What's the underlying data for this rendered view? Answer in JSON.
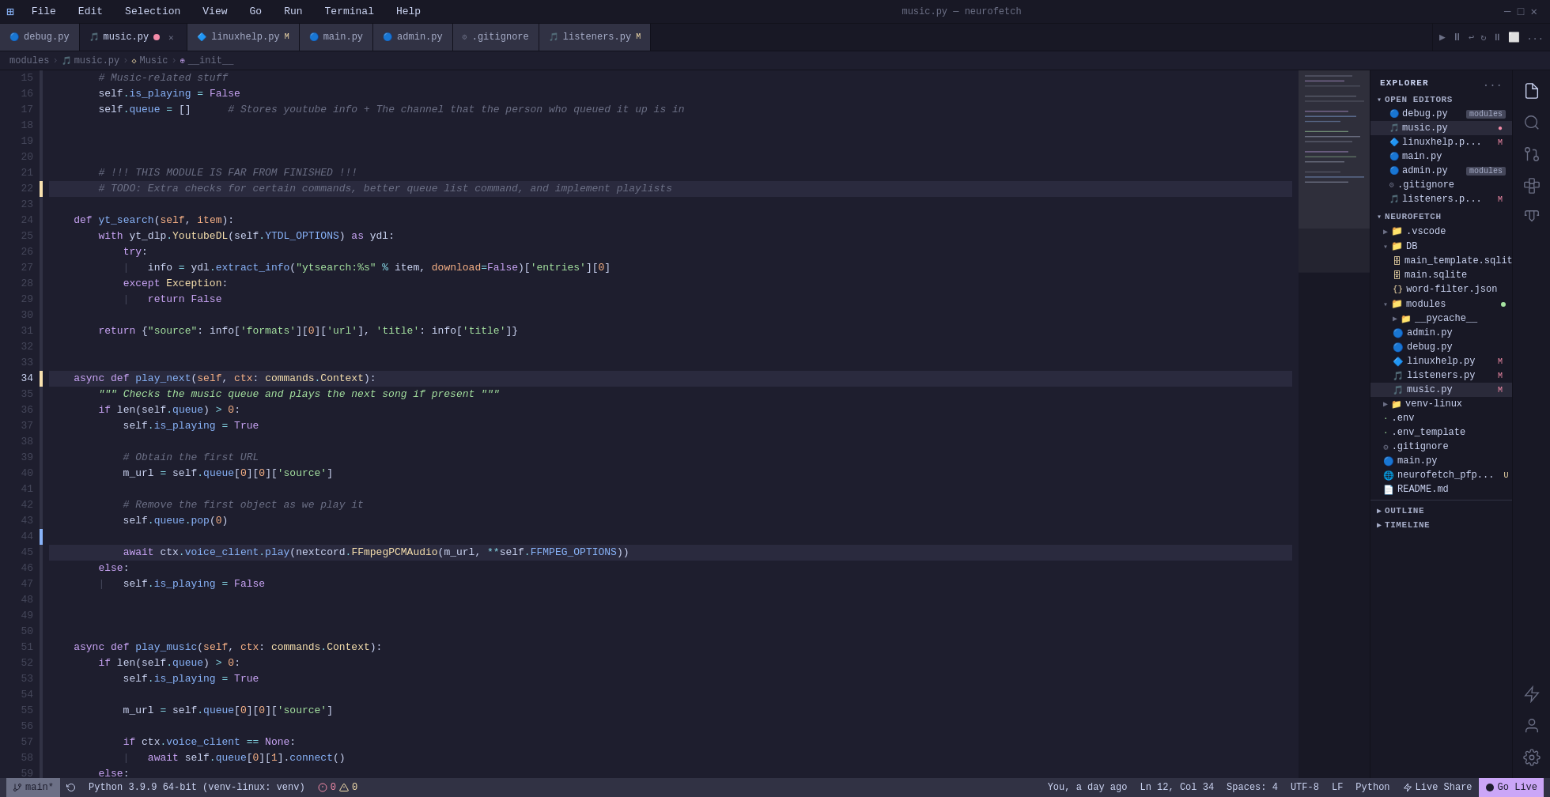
{
  "titlebar": {
    "menus": [
      "File",
      "Edit",
      "Selection",
      "View",
      "Go",
      "Run",
      "Terminal",
      "Help"
    ]
  },
  "tabs": [
    {
      "id": "debug",
      "label": "debug.py",
      "icon": "🔵",
      "active": false,
      "modified": false,
      "closable": false
    },
    {
      "id": "music",
      "label": "music.py",
      "icon": "🎵",
      "active": true,
      "modified": true,
      "closable": true
    },
    {
      "id": "linuxhelp",
      "label": "linuxhelp.py",
      "icon": "🔷",
      "active": false,
      "modified": true,
      "closable": false
    },
    {
      "id": "main",
      "label": "main.py",
      "icon": "🔵",
      "active": false,
      "modified": false,
      "closable": false
    },
    {
      "id": "admin",
      "label": "admin.py",
      "icon": "🔵",
      "active": false,
      "modified": false,
      "closable": false
    },
    {
      "id": "gitignore",
      "label": ".gitignore",
      "icon": "⚙",
      "active": false,
      "modified": false,
      "closable": false
    },
    {
      "id": "listeners",
      "label": "listeners.py",
      "icon": "🎵",
      "active": false,
      "modified": true,
      "closable": false
    }
  ],
  "breadcrumb": {
    "parts": [
      "modules",
      "music.py",
      "Music",
      "__init__"
    ]
  },
  "toolbar": {
    "run_icon": "▶",
    "debug_icon": "⏸",
    "step_back": "⟵",
    "step": "⏩",
    "stop": "⏹",
    "split": "⬜",
    "more": "..."
  },
  "code": {
    "lines": [
      {
        "n": 15,
        "text": "        # Music-related stuff",
        "type": "comment"
      },
      {
        "n": 16,
        "text": "        self.is_playing = False",
        "type": "code"
      },
      {
        "n": 17,
        "text": "        self.queue = []      # Stores youtube info + The channel that the person who queued it up is in",
        "type": "code"
      },
      {
        "n": 18,
        "text": "",
        "type": "empty"
      },
      {
        "n": 19,
        "text": "",
        "type": "empty"
      },
      {
        "n": 20,
        "text": "",
        "type": "empty"
      },
      {
        "n": 21,
        "text": "        # !!! THIS MODULE IS FAR FROM FINISHED !!!",
        "type": "comment"
      },
      {
        "n": 22,
        "text": "        # TODO: Extra checks for certain commands, better queue list command, and implement playlists",
        "type": "comment",
        "highlighted": true
      },
      {
        "n": 23,
        "text": "",
        "type": "empty"
      },
      {
        "n": 24,
        "text": "    def yt_search(self, item):",
        "type": "code"
      },
      {
        "n": 25,
        "text": "        with yt_dlp.YoutubeDL(self.YTDL_OPTIONS) as ydl:",
        "type": "code"
      },
      {
        "n": 26,
        "text": "            try:",
        "type": "code"
      },
      {
        "n": 27,
        "text": "            |   info = ydl.extract_info(\"ytsearch:%s\" % item, download=False)['entries'][0]",
        "type": "code"
      },
      {
        "n": 28,
        "text": "            except Exception:",
        "type": "code"
      },
      {
        "n": 29,
        "text": "            |   return False",
        "type": "code"
      },
      {
        "n": 30,
        "text": "",
        "type": "empty"
      },
      {
        "n": 31,
        "text": "        return {\"source\": info['formats'][0]['url'], 'title': info['title']}",
        "type": "code"
      },
      {
        "n": 32,
        "text": "",
        "type": "empty"
      },
      {
        "n": 33,
        "text": "",
        "type": "empty"
      },
      {
        "n": 34,
        "text": "    async def play_next(self, ctx: commands.Context):",
        "type": "code",
        "highlighted": true
      },
      {
        "n": 35,
        "text": "        \"\"\" Checks the music queue and plays the next song if present \"\"\"",
        "type": "docstring"
      },
      {
        "n": 36,
        "text": "        if len(self.queue) > 0:",
        "type": "code"
      },
      {
        "n": 37,
        "text": "            self.is_playing = True",
        "type": "code"
      },
      {
        "n": 38,
        "text": "",
        "type": "empty"
      },
      {
        "n": 39,
        "text": "            # Obtain the first URL",
        "type": "comment"
      },
      {
        "n": 40,
        "text": "            m_url = self.queue[0][0]['source']",
        "type": "code"
      },
      {
        "n": 41,
        "text": "",
        "type": "empty"
      },
      {
        "n": 42,
        "text": "            # Remove the first object as we play it",
        "type": "comment"
      },
      {
        "n": 43,
        "text": "            self.queue.pop(0)",
        "type": "code"
      },
      {
        "n": 44,
        "text": "",
        "type": "empty"
      },
      {
        "n": 45,
        "text": "            await ctx.voice_client.play(nextcord.FFmpegPCMAudio(m_url, **self.FFMPEG_OPTIONS))",
        "type": "code",
        "highlighted": true
      },
      {
        "n": 46,
        "text": "        else:",
        "type": "code"
      },
      {
        "n": 47,
        "text": "        |   self.is_playing = False",
        "type": "code"
      },
      {
        "n": 48,
        "text": "",
        "type": "empty"
      },
      {
        "n": 49,
        "text": "",
        "type": "empty"
      },
      {
        "n": 50,
        "text": "",
        "type": "empty"
      },
      {
        "n": 51,
        "text": "    async def play_music(self, ctx: commands.Context):",
        "type": "code"
      },
      {
        "n": 52,
        "text": "        if len(self.queue) > 0:",
        "type": "code"
      },
      {
        "n": 53,
        "text": "            self.is_playing = True",
        "type": "code"
      },
      {
        "n": 54,
        "text": "",
        "type": "empty"
      },
      {
        "n": 55,
        "text": "            m_url = self.queue[0][0]['source']",
        "type": "code"
      },
      {
        "n": 56,
        "text": "",
        "type": "empty"
      },
      {
        "n": 57,
        "text": "            if ctx.voice_client == None:",
        "type": "code"
      },
      {
        "n": 58,
        "text": "            |   await self.queue[0][1].connect()",
        "type": "code"
      },
      {
        "n": 59,
        "text": "        else:",
        "type": "code"
      }
    ]
  },
  "explorer": {
    "title": "EXPLORER",
    "more_icon": "...",
    "open_editors_title": "OPEN EDITORS",
    "open_editors": [
      {
        "name": "debug.py",
        "extra": "modules",
        "modified": false
      },
      {
        "name": "music.py",
        "extra": "",
        "modified": true,
        "active": true
      },
      {
        "name": "linuxhelp.p...",
        "extra": "M",
        "modified": true
      },
      {
        "name": "main.py",
        "extra": "",
        "modified": false
      },
      {
        "name": "admin.py",
        "extra": "modules",
        "modified": false
      },
      {
        "name": ".gitignore",
        "extra": "",
        "modified": false
      },
      {
        "name": "listeners.p...",
        "extra": "M",
        "modified": true
      }
    ],
    "neurofetch_title": "NEUROFETCH",
    "folders": [
      {
        "name": ".vscode",
        "indent": 1,
        "is_folder": true
      },
      {
        "name": "DB",
        "indent": 1,
        "is_folder": true,
        "expanded": true
      },
      {
        "name": "main_template.sqlite",
        "indent": 2,
        "is_folder": false,
        "icon": "🗄"
      },
      {
        "name": "main.sqlite",
        "indent": 2,
        "is_folder": false,
        "icon": "🗄"
      },
      {
        "name": "word-filter.json",
        "indent": 2,
        "is_folder": false,
        "icon": "{}"
      },
      {
        "name": "modules",
        "indent": 1,
        "is_folder": true,
        "expanded": true,
        "dot": "green"
      },
      {
        "name": "__pycache__",
        "indent": 2,
        "is_folder": true
      },
      {
        "name": "admin.py",
        "indent": 2,
        "is_folder": false
      },
      {
        "name": "debug.py",
        "indent": 2,
        "is_folder": false
      },
      {
        "name": "linuxhelp.py",
        "indent": 2,
        "is_folder": false,
        "badge": "M"
      },
      {
        "name": "listeners.py",
        "indent": 2,
        "is_folder": false,
        "badge": "M"
      },
      {
        "name": "music.py",
        "indent": 2,
        "is_folder": false,
        "badge": "M",
        "active": true
      },
      {
        "name": "venv-linux",
        "indent": 1,
        "is_folder": true
      },
      {
        "name": ".env",
        "indent": 1,
        "is_folder": false
      },
      {
        "name": ".env_template",
        "indent": 1,
        "is_folder": false
      },
      {
        "name": ".gitignore",
        "indent": 1,
        "is_folder": false
      },
      {
        "name": "main.py",
        "indent": 1,
        "is_folder": false
      },
      {
        "name": "neurofetch_pfp...",
        "indent": 1,
        "is_folder": false,
        "badge": "U"
      },
      {
        "name": "README.md",
        "indent": 1,
        "is_folder": false
      }
    ],
    "outline_title": "OUTLINE",
    "timeline_title": "TIMELINE"
  },
  "activity_bar": {
    "icons": [
      {
        "name": "files-icon",
        "symbol": "📋",
        "active": true
      },
      {
        "name": "search-icon",
        "symbol": "🔍"
      },
      {
        "name": "source-control-icon",
        "symbol": "⑂"
      },
      {
        "name": "extensions-icon",
        "symbol": "⊞"
      },
      {
        "name": "test-icon",
        "symbol": "⚗"
      },
      {
        "name": "lightning-icon",
        "symbol": "⚡"
      },
      {
        "name": "settings-icon",
        "symbol": "⚙"
      },
      {
        "name": "account-icon",
        "symbol": "👤"
      }
    ]
  },
  "status_bar": {
    "branch": "main*",
    "python": "Python 3.9.9 64-bit (venv-linux: venv)",
    "errors": "0",
    "warnings": "0",
    "line_col": "Ln 12, Col 34",
    "spaces": "Spaces: 4",
    "encoding": "UTF-8",
    "line_ending": "LF",
    "language": "Python",
    "live_share": "Live Share",
    "go_live": "Go Live",
    "user_info": "You, a day ago",
    "sync_icon": "🔄"
  }
}
